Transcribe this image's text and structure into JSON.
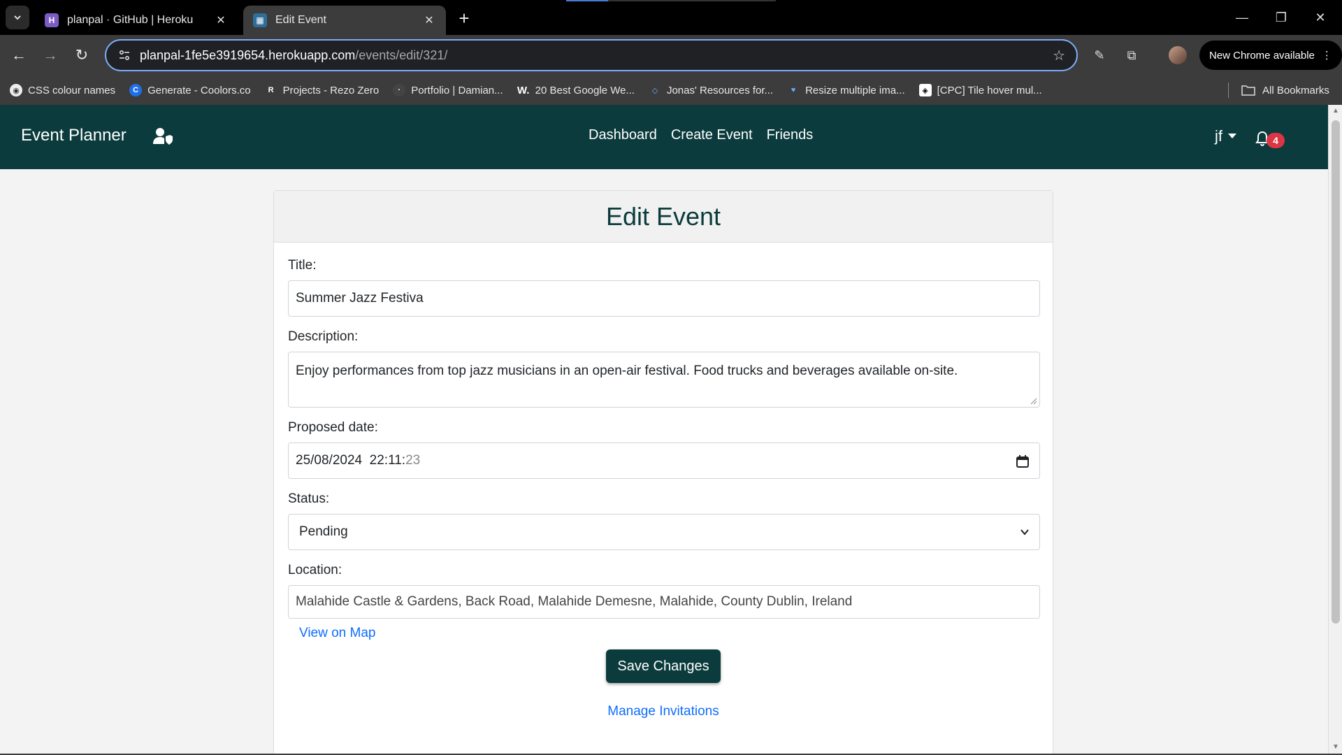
{
  "browser": {
    "tabs": [
      {
        "title": "planpal · GitHub | Heroku",
        "favicon": "heroku-icon",
        "active": false
      },
      {
        "title": "Edit Event",
        "favicon": "event-planner-icon",
        "active": true
      }
    ],
    "url_host": "planpal-1fe5e3919654.herokuapp.com",
    "url_path": "/events/edit/321/",
    "update_label": "New Chrome available",
    "bookmarks": [
      {
        "label": "CSS colour names",
        "icon": "globe-icon"
      },
      {
        "label": "Generate - Coolors.co",
        "icon": "coolors-icon"
      },
      {
        "label": "Projects - Rezo Zero",
        "icon": "rezo-icon"
      },
      {
        "label": "Portfolio | Damian...",
        "icon": "portfolio-icon"
      },
      {
        "label": "20 Best Google We...",
        "icon": "w-icon"
      },
      {
        "label": "Jonas' Resources for...",
        "icon": "diamond-icon"
      },
      {
        "label": "Resize multiple ima...",
        "icon": "heart-icon"
      },
      {
        "label": "[CPC] Tile hover mul...",
        "icon": "codepen-icon"
      }
    ],
    "all_bookmarks_label": "All Bookmarks"
  },
  "app": {
    "brand": "Event Planner",
    "nav": [
      "Dashboard",
      "Create Event",
      "Friends"
    ],
    "user": "jf",
    "notification_count": "4",
    "accent_color": "#0b3b3c"
  },
  "form": {
    "heading": "Edit Event",
    "title_label": "Title:",
    "title_value": "Summer Jazz Festiva",
    "description_label": "Description:",
    "description_value": "Enjoy performances from top jazz musicians in an open-air festival. Food trucks and beverages available on-site.",
    "date_label": "Proposed date:",
    "date_value_main": "25/08/2024  22:11:",
    "date_value_seconds": "23",
    "status_label": "Status:",
    "status_value": "Pending",
    "location_label": "Location:",
    "location_value": "Malahide Castle & Gardens, Back Road, Malahide Demesne, Malahide, County Dublin, Ireland",
    "map_link": "View on Map",
    "save_label": "Save Changes",
    "manage_link": "Manage Invitations"
  }
}
